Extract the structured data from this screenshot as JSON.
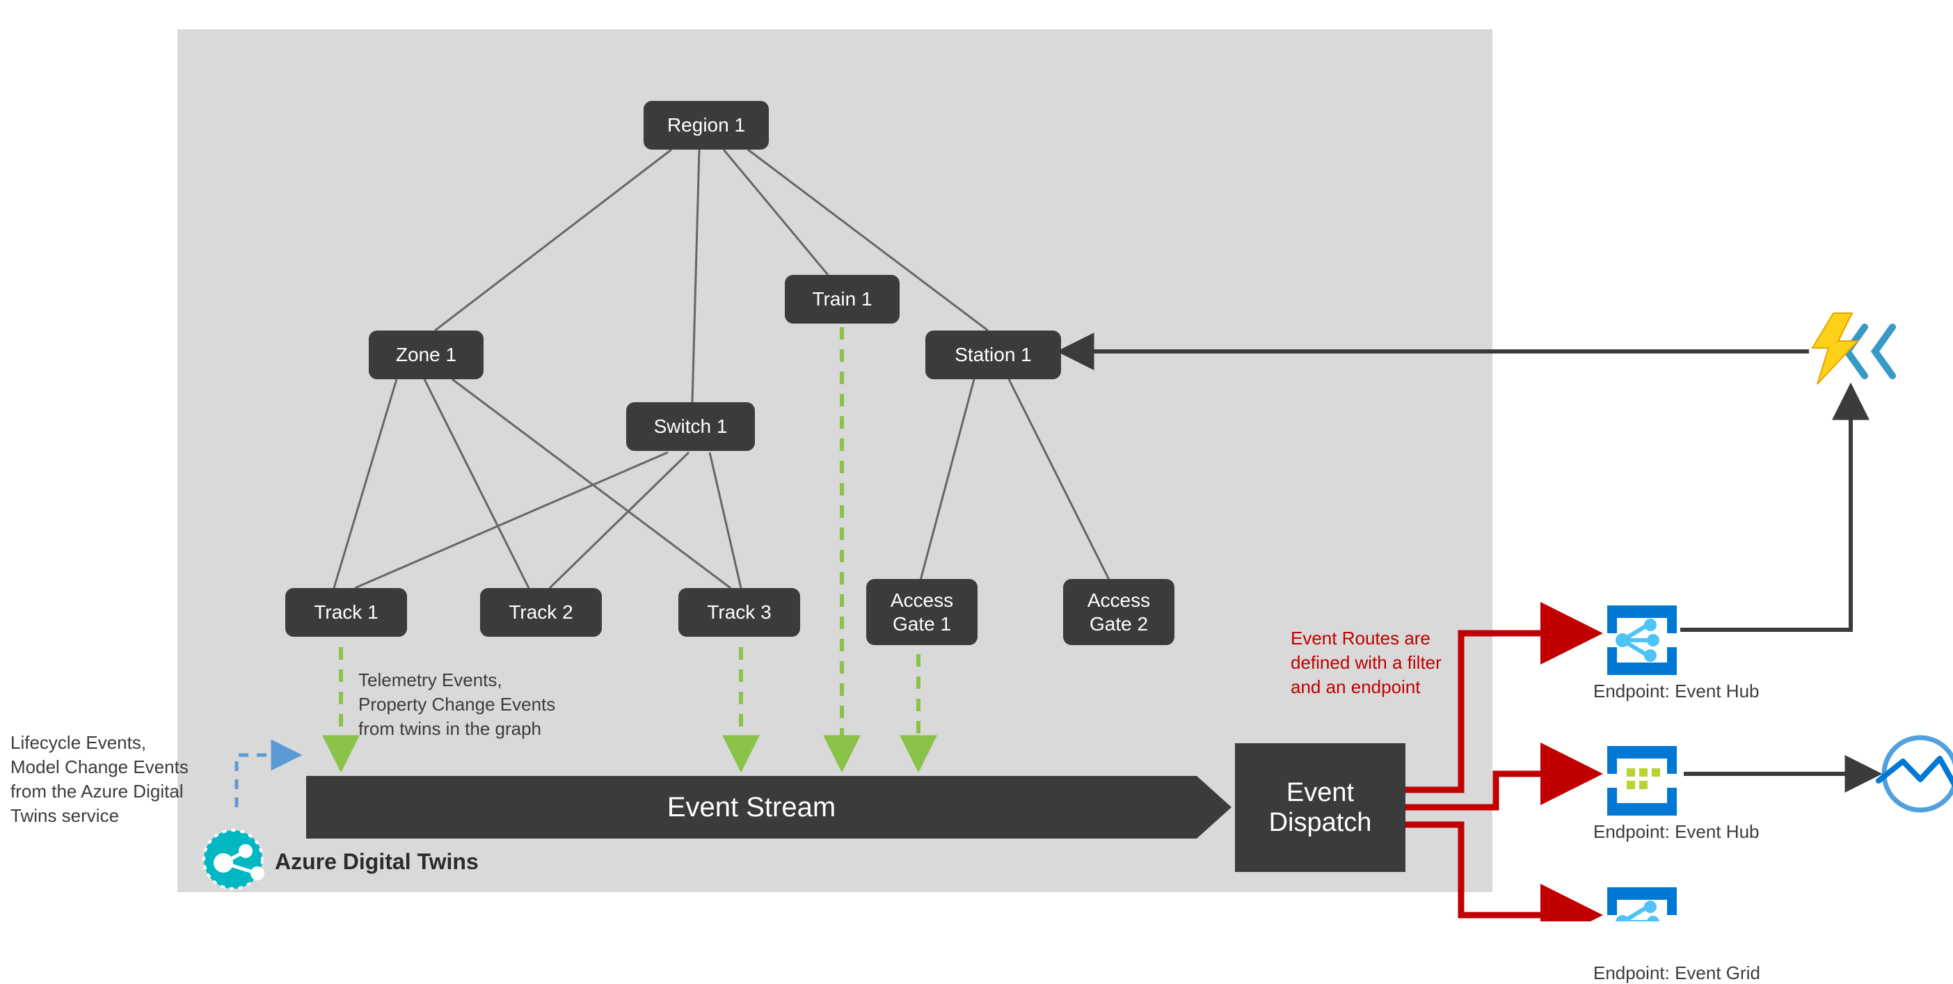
{
  "nodes": {
    "region1": "Region 1",
    "zone1": "Zone 1",
    "train1": "Train 1",
    "station1": "Station 1",
    "switch1": "Switch 1",
    "track1": "Track 1",
    "track2": "Track 2",
    "track3": "Track 3",
    "gate1": "Access\nGate 1",
    "gate2": "Access\nGate 2"
  },
  "stream_label": "Event Stream",
  "dispatch_label": "Event\nDispatch",
  "annotations": {
    "telemetry": "Telemetry Events,\nProperty Change Events\nfrom twins in the graph",
    "lifecycle": "Lifecycle Events,\nModel Change Events\nfrom the Azure Digital\nTwins service",
    "routes": "Event Routes are\ndefined with a filter\nand an endpoint"
  },
  "adt_label": "Azure Digital Twins",
  "endpoints": {
    "eventhub1": "Endpoint: Event Hub",
    "eventhub2": "Endpoint: Event Hub",
    "eventgrid": "Endpoint: Event Grid"
  },
  "colors": {
    "node_bg": "#3b3b3b",
    "gray_panel": "#d9d9d9",
    "route_red": "#c00000",
    "green_dash": "#8bc34a",
    "blue_dash": "#5b9bd5",
    "azure_blue": "#0078d4",
    "adt_teal": "#00b7c3",
    "bolt_yellow": "#ffc000",
    "tsi_blue": "#50a0e0"
  }
}
